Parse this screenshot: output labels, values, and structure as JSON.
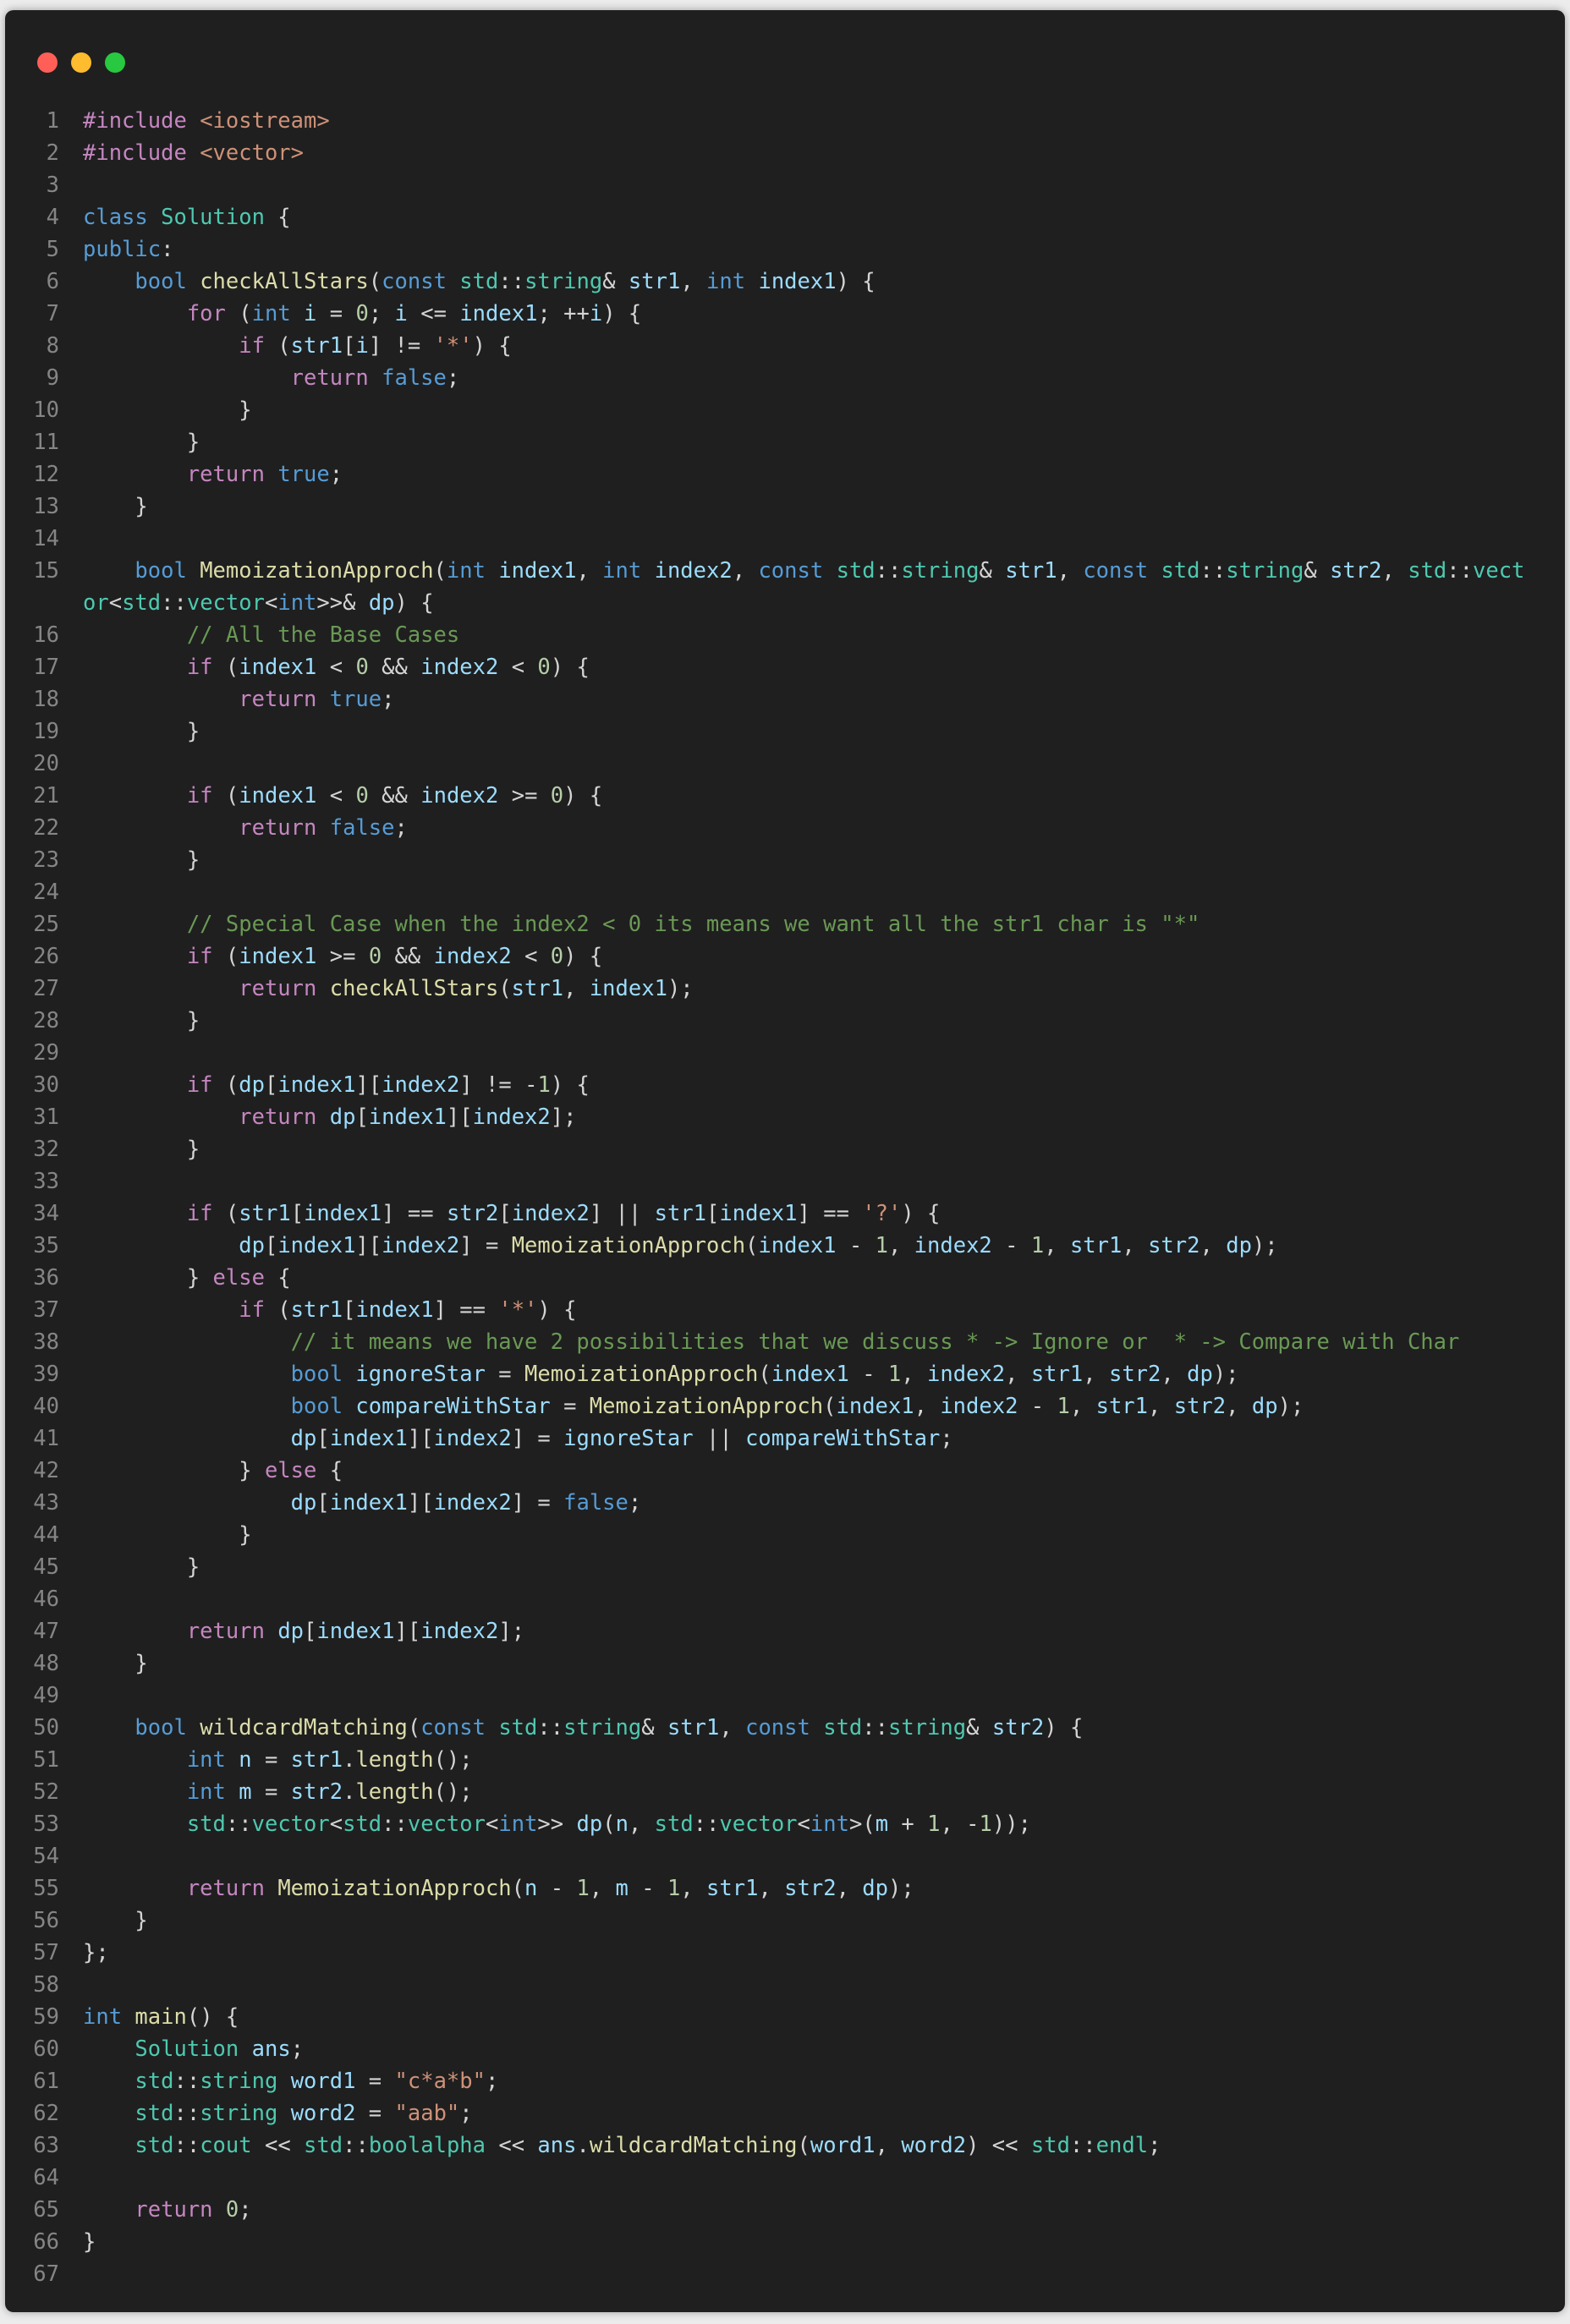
{
  "window": {
    "controls": [
      "close",
      "minimize",
      "maximize"
    ],
    "colors": {
      "close": "#ff5f57",
      "minimize": "#febc2e",
      "maximize": "#28c840",
      "background": "#1f1f1f"
    }
  },
  "code": {
    "language": "cpp",
    "lines": [
      "#include <iostream>",
      "#include <vector>",
      "",
      "class Solution {",
      "public:",
      "    bool checkAllStars(const std::string& str1, int index1) {",
      "        for (int i = 0; i <= index1; ++i) {",
      "            if (str1[i] != '*') {",
      "                return false;",
      "            }",
      "        }",
      "        return true;",
      "    }",
      "",
      "    bool MemoizationApproch(int index1, int index2, const std::string& str1, const std::string& str2, std::vector<std::vector<int>>& dp) {",
      "        // All the Base Cases",
      "        if (index1 < 0 && index2 < 0) {",
      "            return true;",
      "        }",
      "",
      "        if (index1 < 0 && index2 >= 0) {",
      "            return false;",
      "        }",
      "",
      "        // Special Case when the index2 < 0 its means we want all the str1 char is \"*\"",
      "        if (index1 >= 0 && index2 < 0) {",
      "            return checkAllStars(str1, index1);",
      "        }",
      "",
      "        if (dp[index1][index2] != -1) {",
      "            return dp[index1][index2];",
      "        }",
      "",
      "        if (str1[index1] == str2[index2] || str1[index1] == '?') {",
      "            dp[index1][index2] = MemoizationApproch(index1 - 1, index2 - 1, str1, str2, dp);",
      "        } else {",
      "            if (str1[index1] == '*') {",
      "                // it means we have 2 possibilities that we discuss * -> Ignore or  * -> Compare with Char",
      "                bool ignoreStar = MemoizationApproch(index1 - 1, index2, str1, str2, dp);",
      "                bool compareWithStar = MemoizationApproch(index1, index2 - 1, str1, str2, dp);",
      "                dp[index1][index2] = ignoreStar || compareWithStar;",
      "            } else {",
      "                dp[index1][index2] = false;",
      "            }",
      "        }",
      "",
      "        return dp[index1][index2];",
      "    }",
      "",
      "    bool wildcardMatching(const std::string& str1, const std::string& str2) {",
      "        int n = str1.length();",
      "        int m = str2.length();",
      "        std::vector<std::vector<int>> dp(n, std::vector<int>(m + 1, -1));",
      "",
      "        return MemoizationApproch(n - 1, m - 1, str1, str2, dp);",
      "    }",
      "};",
      "",
      "int main() {",
      "    Solution ans;",
      "    std::string word1 = \"c*a*b\";",
      "    std::string word2 = \"aab\";",
      "    std::cout << std::boolalpha << ans.wildcardMatching(word1, word2) << std::endl;",
      "",
      "    return 0;",
      "}",
      ""
    ]
  }
}
